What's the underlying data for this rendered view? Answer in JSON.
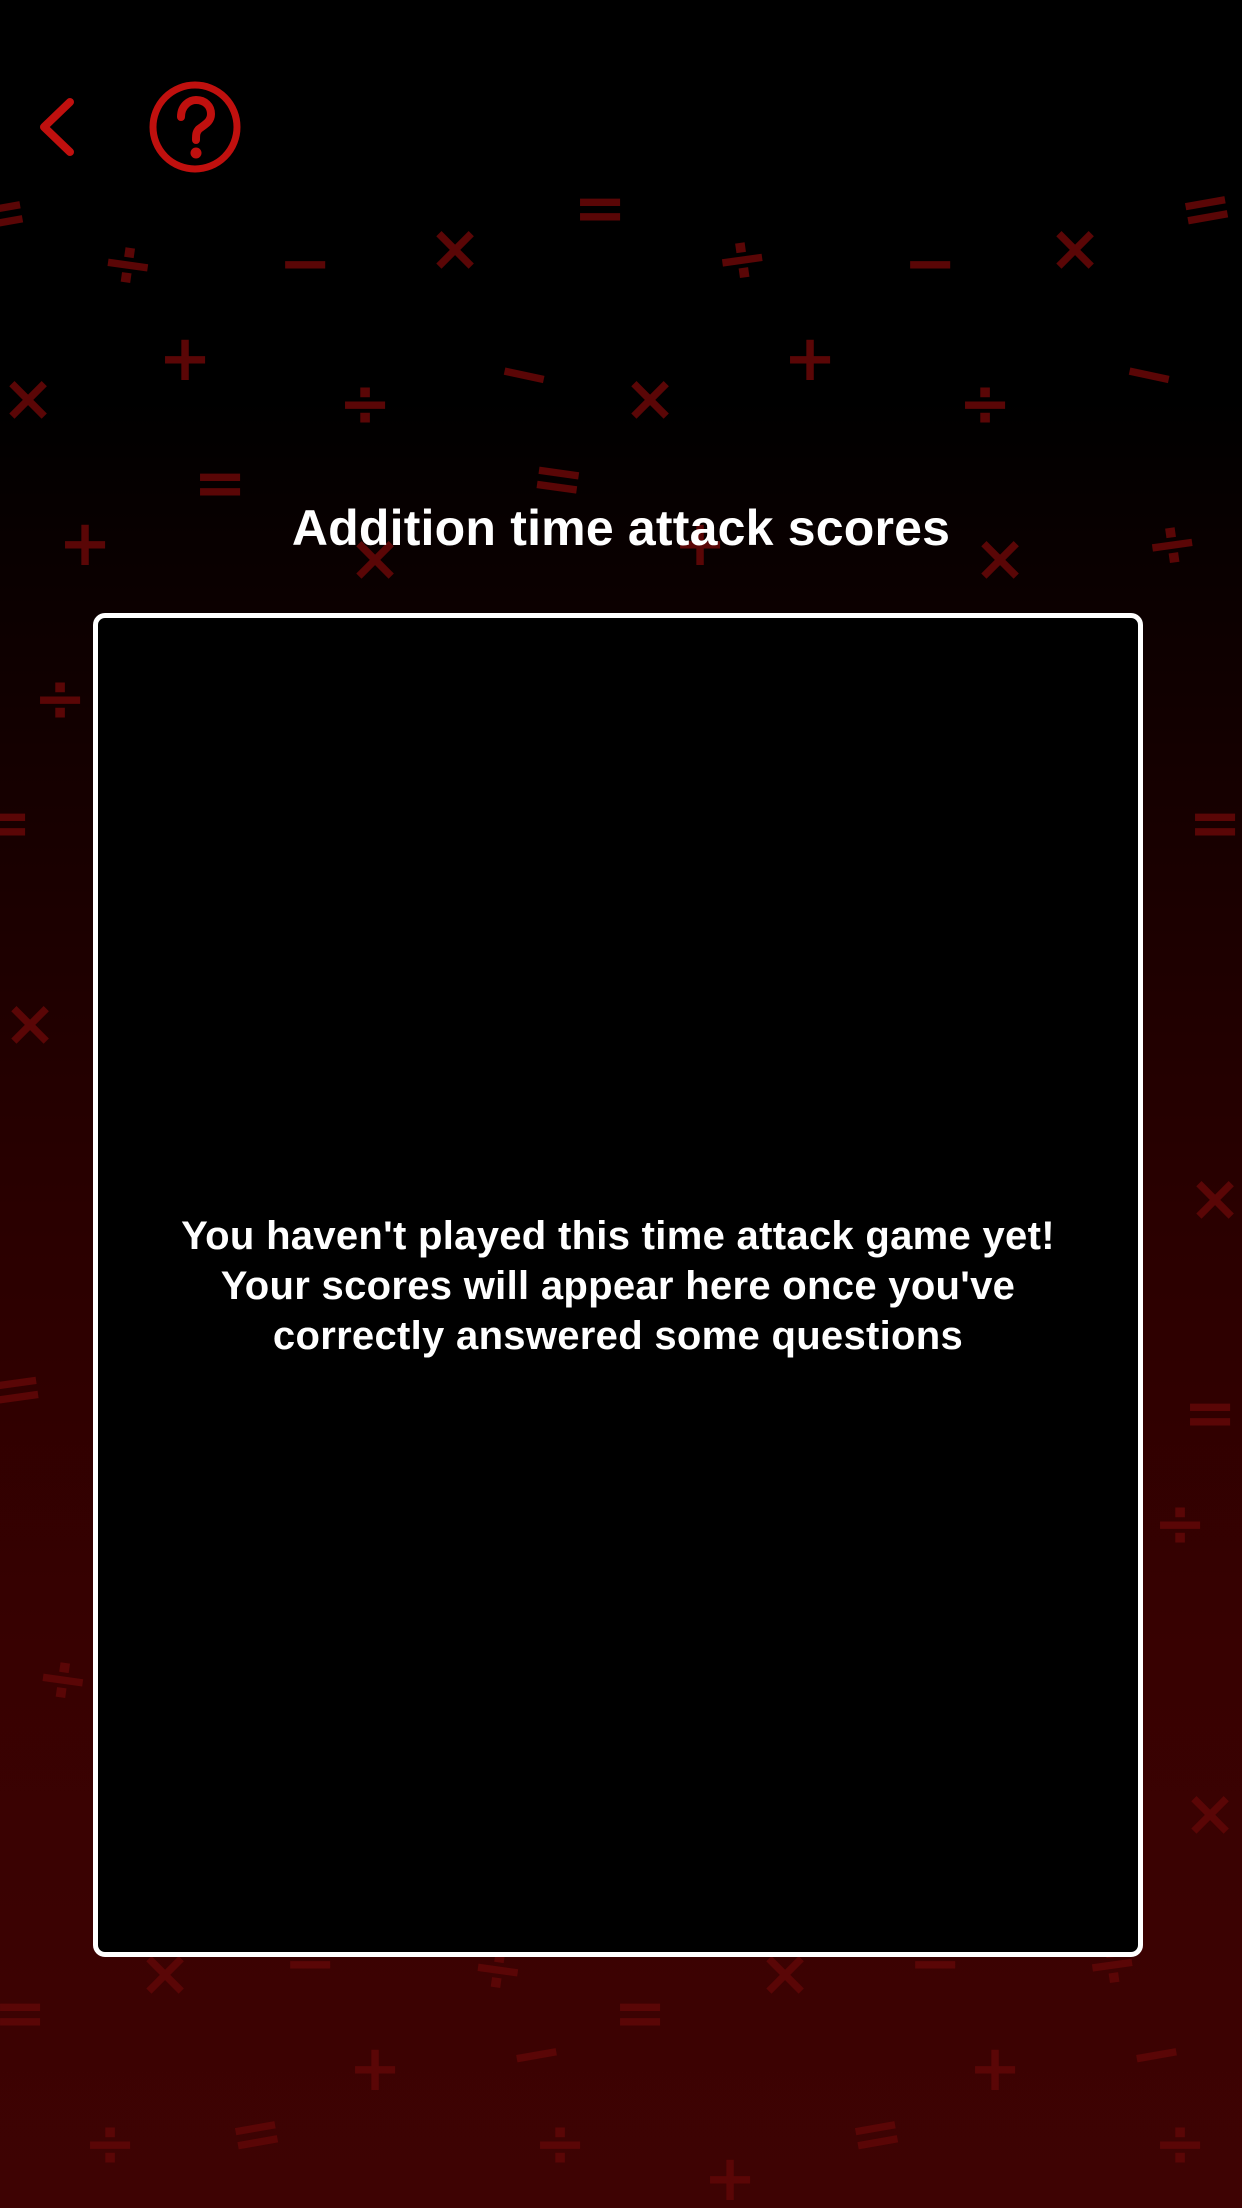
{
  "header": {
    "back_icon": "chevron-left-icon",
    "help_icon": "question-circle-icon"
  },
  "title": "Addition time attack scores",
  "scores_panel": {
    "empty_message": "You haven't played this time attack game yet! Your scores will appear here once you've correctly answered some questions"
  },
  "background": {
    "symbols": [
      "+",
      "−",
      "×",
      "÷",
      "="
    ]
  },
  "colors": {
    "accent": "#c0100e",
    "pattern": "#5a0606",
    "panel_border": "#ffffff",
    "panel_fill": "#000000",
    "text": "#ffffff"
  }
}
